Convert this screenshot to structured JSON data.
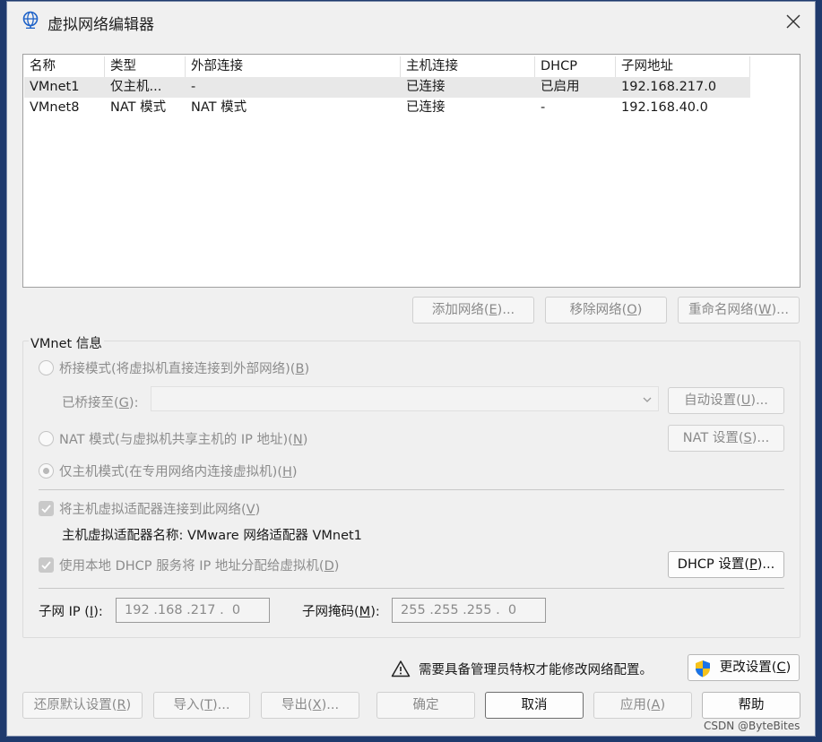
{
  "window": {
    "title": "虚拟网络编辑器"
  },
  "table": {
    "headers": [
      "名称",
      "类型",
      "外部连接",
      "主机连接",
      "DHCP",
      "子网地址"
    ],
    "rows": [
      [
        "VMnet1",
        "仅主机...",
        "-",
        "已连接",
        "已启用",
        "192.168.217.0"
      ],
      [
        "VMnet8",
        "NAT 模式",
        "NAT 模式",
        "已连接",
        "-",
        "192.168.40.0"
      ]
    ]
  },
  "list_buttons": {
    "add": {
      "text": "添加网络(",
      "key": "E",
      "tail": ")..."
    },
    "remove": {
      "text": "移除网络(",
      "key": "O",
      "tail": ")"
    },
    "rename": {
      "text": "重命名网络(",
      "key": "W",
      "tail": ")..."
    }
  },
  "vmnet_info": {
    "group_title": "VMnet 信息",
    "bridged": {
      "text": "桥接模式(将虚拟机直接连接到外部网络)(",
      "key": "B",
      "tail": ")"
    },
    "bridged_to": {
      "text": "已桥接至(",
      "key": "G",
      "tail": "):",
      "value": ""
    },
    "auto_settings": {
      "text": "自动设置(",
      "key": "U",
      "tail": ")..."
    },
    "nat": {
      "text": "NAT 模式(与虚拟机共享主机的 IP 地址)(",
      "key": "N",
      "tail": ")"
    },
    "nat_settings": {
      "text": "NAT 设置(",
      "key": "S",
      "tail": ")..."
    },
    "host_only": {
      "text": "仅主机模式(在专用网络内连接虚拟机)(",
      "key": "H",
      "tail": ")"
    },
    "connect_adapter": {
      "text": "将主机虚拟适配器连接到此网络(",
      "key": "V",
      "tail": ")"
    },
    "adapter_name": "主机虚拟适配器名称: VMware 网络适配器 VMnet1",
    "use_dhcp": {
      "text": "使用本地 DHCP 服务将 IP 地址分配给虚拟机(",
      "key": "D",
      "tail": ")"
    },
    "dhcp_settings": {
      "text": "DHCP 设置(",
      "key": "P",
      "tail": ")..."
    },
    "subnet_ip": {
      "text": "子网 IP (",
      "key": "I",
      "tail": "):",
      "value": "192 .168 .217 .  0"
    },
    "subnet_mask": {
      "text": "子网掩码(",
      "key": "M",
      "tail": "):",
      "value": "255 .255 .255 .  0"
    }
  },
  "admin": {
    "notice": "需要具备管理员特权才能修改网络配置。",
    "change_settings": {
      "text": "更改设置(",
      "key": "C",
      "tail": ")"
    }
  },
  "footer_buttons": {
    "restore": {
      "text": "还原默认设置(",
      "key": "R",
      "tail": ")"
    },
    "import": {
      "text": "导入(",
      "key": "T",
      "tail": ")..."
    },
    "export": {
      "text": "导出(",
      "key": "X",
      "tail": ")..."
    },
    "ok": "确定",
    "cancel": "取消",
    "apply": {
      "text": "应用(",
      "key": "A",
      "tail": ")"
    },
    "help": "帮助"
  },
  "watermark": "CSDN @ByteBites",
  "colors": {
    "title_bar_bg": "#f0f0f0",
    "desktop_bg": "#1f3a6d",
    "shield_blue": "#1a73e8",
    "shield_yellow": "#f6c21c"
  }
}
